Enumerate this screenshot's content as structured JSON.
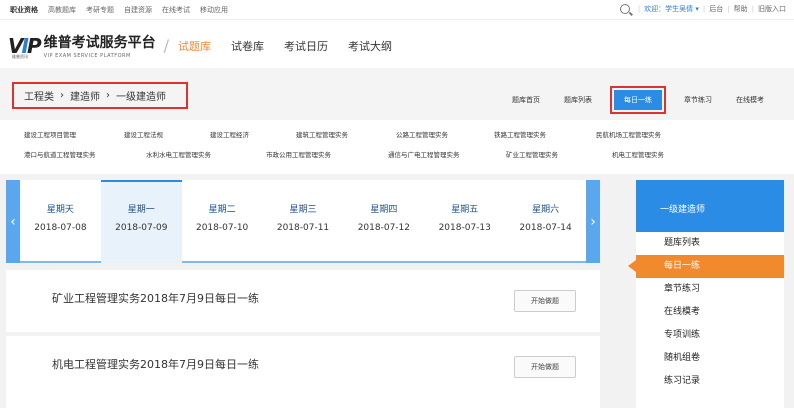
{
  "topbar": {
    "links": [
      "职业资格",
      "高教题库",
      "考研专题",
      "自建资源",
      "在线考试",
      "移动应用"
    ],
    "welcome": "欢迎：学生吴倩 ▾",
    "links_right": [
      "后台",
      "帮助",
      "旧版入口"
    ],
    "sep": "|"
  },
  "header": {
    "logo_vip": "VIP",
    "logo_vip_sub": "维普资讯",
    "brand_cn": "维普考试服务平台",
    "brand_en": "VIP EXAM  SERVICE PLATFORM",
    "slash": "/",
    "nav": [
      "试题库",
      "试卷库",
      "考试日历",
      "考试大纲"
    ]
  },
  "breadcrumb": {
    "items": [
      "工程类",
      "建造师",
      "一级建造师"
    ],
    "sep": "›"
  },
  "subnav": {
    "items": [
      "题库首页",
      "题库列表",
      "每日一练",
      "章节练习",
      "在线模考"
    ]
  },
  "categories": {
    "row1": [
      "建设工程项目管理",
      "建设工程法规",
      "建设工程经济",
      "建筑工程管理实务",
      "公路工程管理实务",
      "铁路工程管理实务",
      "民航机场工程管理实务"
    ],
    "row2": [
      "港口与航道工程管理实务",
      "水利水电工程管理实务",
      "市政公用工程管理实务",
      "通信与广电工程管理实务",
      "矿业工程管理实务",
      "机电工程管理实务"
    ]
  },
  "week": {
    "prev": "‹",
    "next": "›",
    "days": [
      {
        "name": "星期天",
        "date": "2018-07-08"
      },
      {
        "name": "星期一",
        "date": "2018-07-09"
      },
      {
        "name": "星期二",
        "date": "2018-07-10"
      },
      {
        "name": "星期三",
        "date": "2018-07-11"
      },
      {
        "name": "星期四",
        "date": "2018-07-12"
      },
      {
        "name": "星期五",
        "date": "2018-07-13"
      },
      {
        "name": "星期六",
        "date": "2018-07-14"
      }
    ]
  },
  "cards": [
    {
      "title": "矿业工程管理实务2018年7月9日每日一练",
      "button": "开始做题"
    },
    {
      "title": "机电工程管理实务2018年7月9日每日一练",
      "button": "开始做题"
    }
  ],
  "sidebar": {
    "header": "一级建造师",
    "items": [
      "题库列表",
      "每日一练",
      "章节练习",
      "在线模考",
      "专项训练",
      "随机组卷",
      "练习记录"
    ]
  },
  "colors": {
    "accent_blue": "#2a8ce5",
    "accent_orange": "#f08a2c",
    "highlight_red": "#e03131"
  }
}
